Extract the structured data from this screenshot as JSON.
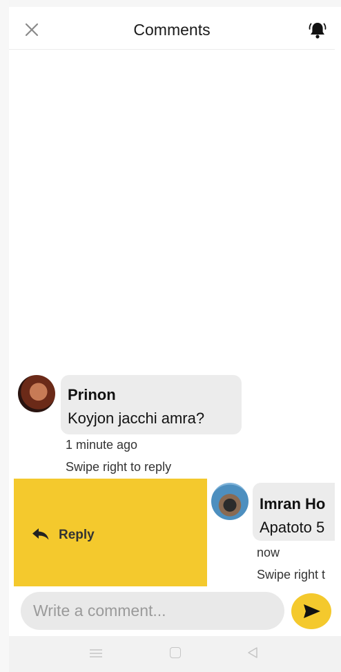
{
  "header": {
    "title": "Comments",
    "close_icon": "close-icon",
    "bell_icon": "bell-icon"
  },
  "comments": [
    {
      "author": "Prinon",
      "text": "Koyjon jacchi amra?",
      "time": "1 minute ago",
      "hint": "Swipe right to reply"
    },
    {
      "author": "Imran Ho",
      "text": "Apatoto 5",
      "time": "now",
      "hint": "Swipe right t"
    }
  ],
  "reply_action": {
    "label": "Reply",
    "icon": "reply-arrow-icon"
  },
  "composer": {
    "placeholder": "Write a comment...",
    "value": "",
    "send_icon": "send-icon"
  },
  "system_nav": {
    "icons": [
      "menu-icon",
      "home-icon",
      "back-icon"
    ]
  },
  "colors": {
    "accent": "#f4c92d",
    "bubble": "#ececec",
    "input_bg": "#e9e9e9"
  }
}
